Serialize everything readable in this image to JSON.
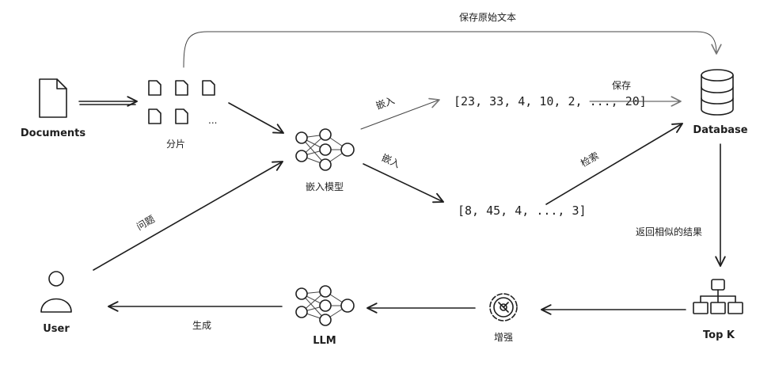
{
  "nodes": {
    "documents": "Documents",
    "chunks": "分片",
    "chunks_ellipsis": "...",
    "embed_model": "嵌入模型",
    "database": "Database",
    "user": "User",
    "llm": "LLM",
    "augment": "增强",
    "topk": "Top K"
  },
  "vectors": {
    "doc_vector": "[23, 33, 4, 10, 2, ..., 20]",
    "query_vector": "[8, 45, 4, ..., 3]"
  },
  "edges": {
    "save_original": "保存原始文本",
    "embed_top": "嵌入",
    "embed_bottom": "嵌入",
    "save": "保存",
    "retrieve": "检索",
    "question": "问题",
    "return_similar": "返回相似的结果",
    "generate": "生成"
  },
  "colors": {
    "ink": "#1e1e1e",
    "background": "#ffffff"
  },
  "icons": {
    "documents": "document-icon",
    "chunks": "file-icon",
    "embed_model": "neural-network-icon",
    "database": "database-icon",
    "user": "user-icon",
    "llm": "neural-network-icon",
    "augment": "gear-icon",
    "topk": "hierarchy-icon"
  }
}
